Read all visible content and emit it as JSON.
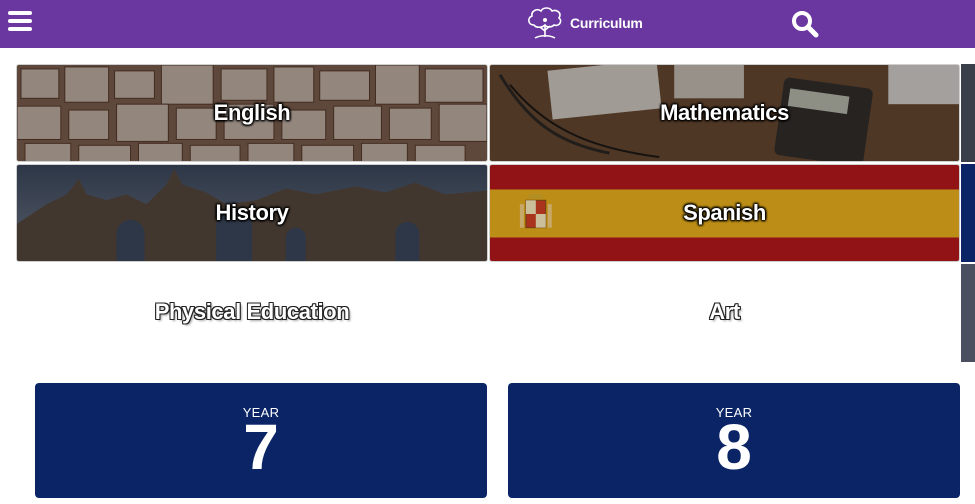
{
  "header": {
    "brand_text": "Curriculum",
    "menu_icon": "hamburger-menu-icon",
    "search_icon": "search-icon",
    "background_color": "#6a37a0"
  },
  "subjects": [
    {
      "label": "English"
    },
    {
      "label": "Mathematics"
    },
    {
      "label": "History"
    },
    {
      "label": "Spanish"
    },
    {
      "label": "Physical Education"
    },
    {
      "label": "Art"
    }
  ],
  "years": [
    {
      "prefix": "YEAR",
      "number": "7"
    },
    {
      "prefix": "YEAR",
      "number": "8"
    }
  ],
  "colors": {
    "year_card": "#0a2466",
    "spain_red": "#a5161a",
    "spain_yellow": "#d7a21b"
  }
}
